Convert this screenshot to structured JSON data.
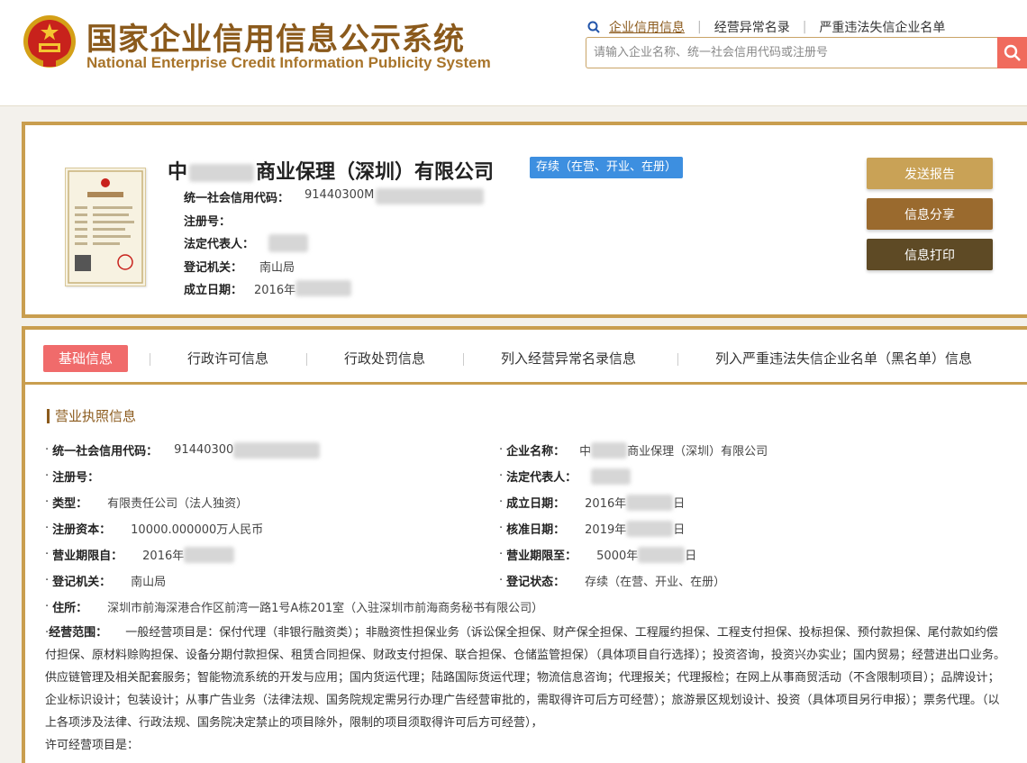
{
  "header": {
    "title_cn": "国家企业信用信息公示系统",
    "title_en": "National Enterprise Credit Information Publicity System",
    "nav": [
      "企业信用信息",
      "经营异常名录",
      "严重违法失信企业名单"
    ],
    "search_placeholder": "请输入企业名称、统一社会信用代码或注册号",
    "colors": {
      "brand": "#8b5a1c",
      "search_button": "#f06b5d"
    }
  },
  "company": {
    "name_prefix": "中",
    "name_suffix": "商业保理（深圳）有限公司",
    "status": "存续（在营、开业、在册）",
    "credit_code_label": "统一社会信用代码：",
    "credit_code_value": "91440300M",
    "reg_no_label": "注册号：",
    "legal_rep_label": "法定代表人：",
    "authority_label": "登记机关：",
    "authority_value": "南山局",
    "established_label": "成立日期：",
    "established_value": "2016年"
  },
  "actions": {
    "send": "发送报告",
    "share": "信息分享",
    "print": "信息打印"
  },
  "tabs": [
    "基础信息",
    "行政许可信息",
    "行政处罚信息",
    "列入经营异常名录信息",
    "列入严重违法失信企业名单（黑名单）信息"
  ],
  "section_title": "营业执照信息",
  "license": {
    "credit_code": {
      "label": "统一社会信用代码：",
      "value": "91440300"
    },
    "company_name": {
      "label": "企业名称：",
      "value_prefix": "中",
      "value_suffix": "商业保理（深圳）有限公司"
    },
    "reg_no": {
      "label": "注册号：",
      "value": ""
    },
    "legal_rep": {
      "label": "法定代表人：",
      "value": ""
    },
    "type": {
      "label": "类型：",
      "value": "有限责任公司（法人独资）"
    },
    "established": {
      "label": "成立日期：",
      "value": "2016年",
      "suffix": "日"
    },
    "capital": {
      "label": "注册资本：",
      "value": "10000.000000万人民币"
    },
    "approved": {
      "label": "核准日期：",
      "value": "2019年",
      "suffix": "日"
    },
    "term_from": {
      "label": "营业期限自：",
      "value": "2016年"
    },
    "term_to": {
      "label": "营业期限至：",
      "value": "5000年",
      "suffix": "日"
    },
    "authority": {
      "label": "登记机关：",
      "value": "南山局"
    },
    "reg_status": {
      "label": "登记状态：",
      "value": "存续（在营、开业、在册）"
    },
    "address": {
      "label": "住所：",
      "value": "深圳市前海深港合作区前湾一路1号A栋201室（入驻深圳市前海商务秘书有限公司）"
    },
    "scope": {
      "label": "经营范围：",
      "value": "一般经营项目是：保付代理（非银行融资类）；非融资性担保业务（诉讼保全担保、财产保全担保、工程履约担保、工程支付担保、投标担保、预付款担保、尾付款如约偿付担保、原材料赊购担保、设备分期付款担保、租赁合同担保、财政支付担保、联合担保、仓储监管担保）（具体项目自行选择）；投资咨询，投资兴办实业；国内贸易；经营进出口业务。供应链管理及相关配套服务；智能物流系统的开发与应用；国内货运代理；陆路国际货运代理；物流信息咨询；代理报关；代理报检；在网上从事商贸活动（不含限制项目）；品牌设计；企业标识设计；包装设计；从事广告业务（法律法规、国务院规定需另行办理广告经营审批的，需取得许可后方可经营）；旅游景区规划设计、投资（具体项目另行申报）；票务代理。（以上各项涉及法律、行政法规、国务院决定禁止的项目除外，限制的项目须取得许可后方可经营），",
      "licensed_label": "许可经营项目是："
    }
  }
}
